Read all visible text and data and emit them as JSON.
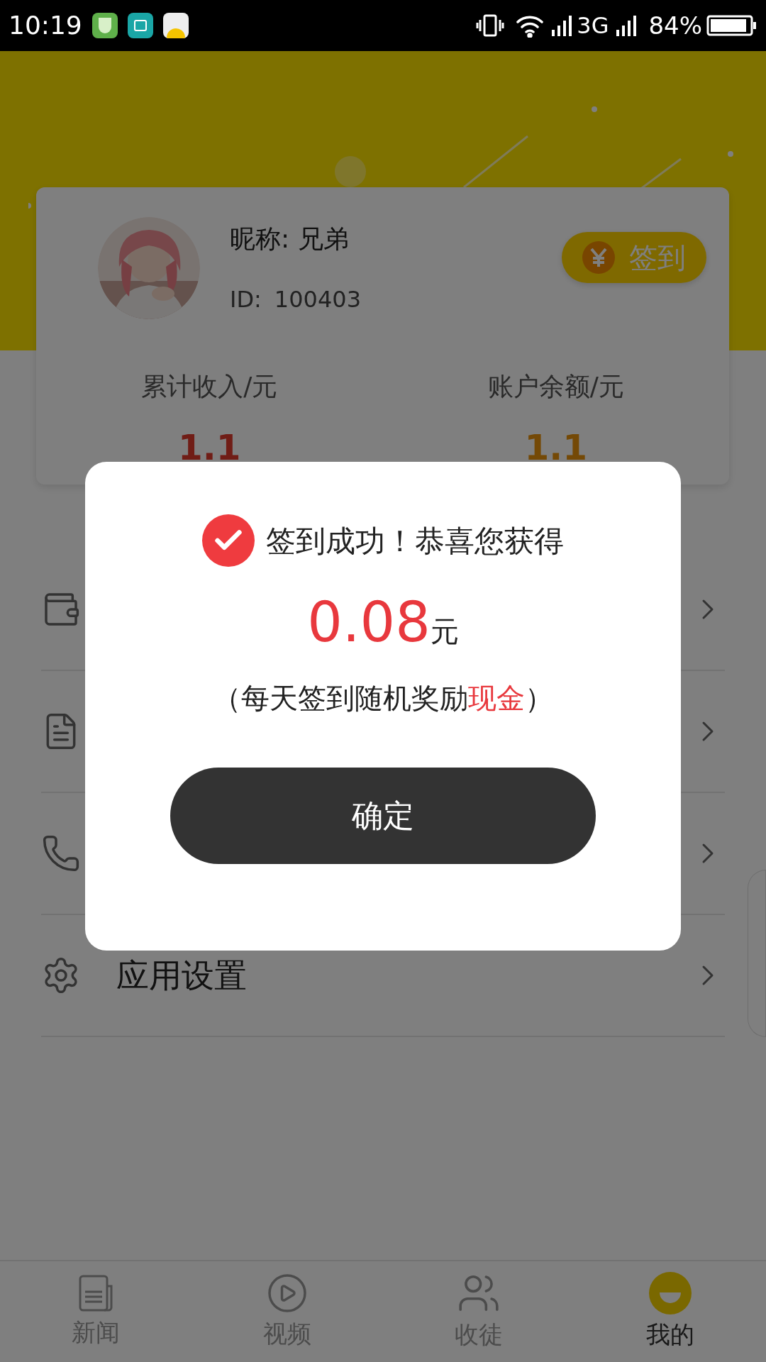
{
  "status_bar": {
    "time": "10:19",
    "network": "3G",
    "battery": "84%"
  },
  "profile": {
    "nickname": "昵称: 兄弟",
    "id_label": "ID:",
    "id_value": "100403",
    "sign_button": "签到"
  },
  "stats": [
    {
      "kind": "income",
      "label": "累计收入/元",
      "value": "1.1"
    },
    {
      "kind": "balance",
      "label": "账户余额/元",
      "value": "1.1"
    }
  ],
  "menu": [
    {
      "kind": "wallet"
    },
    {
      "kind": "document"
    },
    {
      "kind": "phone"
    },
    {
      "kind": "settings",
      "label": "应用设置"
    }
  ],
  "tabs": [
    {
      "kind": "news",
      "label": "新闻",
      "selected": false
    },
    {
      "kind": "video",
      "label": "视频",
      "selected": false
    },
    {
      "kind": "apprentice",
      "label": "收徒",
      "selected": false
    },
    {
      "kind": "mine",
      "label": "我的",
      "selected": true
    }
  ],
  "dialog": {
    "message": "签到成功！恭喜您获得",
    "amount": "0.08",
    "unit": "元",
    "note_prefix": "（每天签到随机奖励",
    "note_highlight": "现金",
    "note_suffix": "）",
    "confirm_button": "确定"
  }
}
